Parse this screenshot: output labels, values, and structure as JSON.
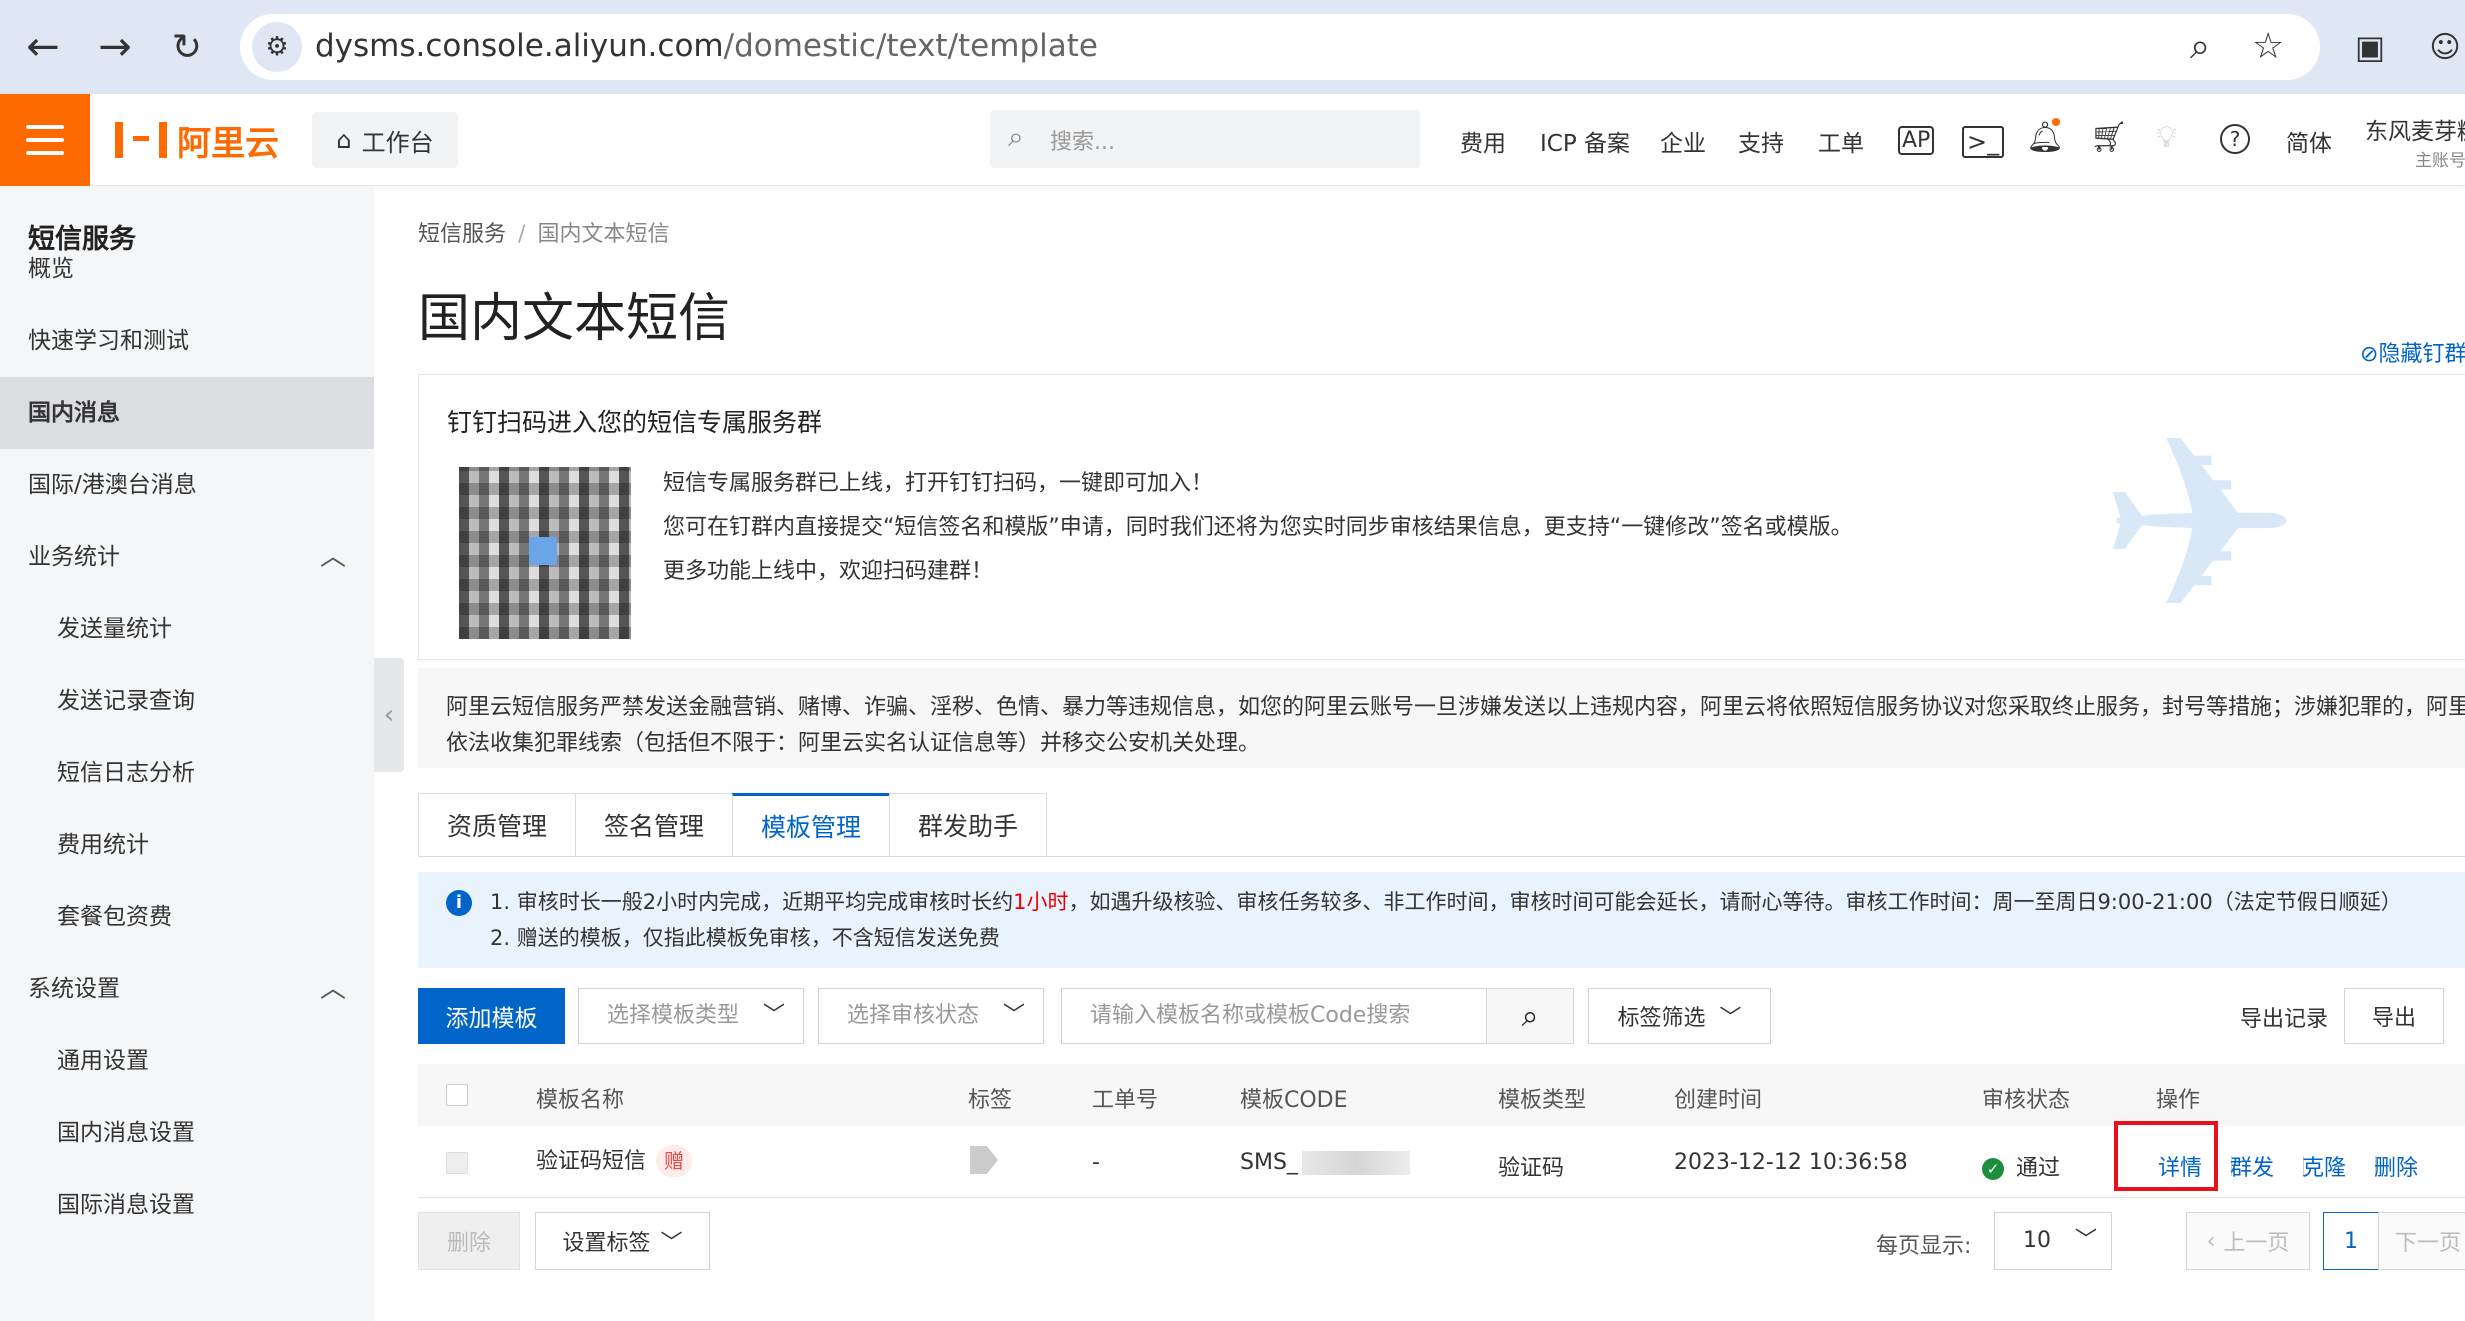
{
  "browser": {
    "url_host": "dysms.console.aliyun.com",
    "url_path": "/domestic/text/template",
    "back_icon": "arrow-left-icon",
    "forward_icon": "arrow-right-icon",
    "reload_icon": "reload-icon"
  },
  "header": {
    "logo_text": "阿里云",
    "workbench_label": "工作台",
    "search_placeholder": "搜索...",
    "nav": [
      "费用",
      "ICP 备案",
      "企业",
      "支持",
      "工单"
    ],
    "lang": "简体",
    "account_name": "东风麦芽糖",
    "account_type": "主账号",
    "accent_color": "#ff6a00"
  },
  "sidebar": {
    "title": "短信服务",
    "items": [
      {
        "label": "概览"
      },
      {
        "label": "快速学习和测试"
      },
      {
        "label": "国内消息"
      },
      {
        "label": "国际/港澳台消息"
      },
      {
        "label": "业务统计"
      },
      {
        "label": "发送量统计"
      },
      {
        "label": "发送记录查询"
      },
      {
        "label": "短信日志分析"
      },
      {
        "label": "费用统计"
      },
      {
        "label": "套餐包资费"
      },
      {
        "label": "系统设置"
      },
      {
        "label": "通用设置"
      },
      {
        "label": "国内消息设置"
      },
      {
        "label": "国际消息设置"
      }
    ]
  },
  "breadcrumb": {
    "root": "短信服务",
    "current": "国内文本短信"
  },
  "page": {
    "title": "国内文本短信",
    "hide_link": "隐藏钉群"
  },
  "ding": {
    "title": "钉钉扫码进入您的短信专属服务群",
    "lines": [
      "短信专属服务群已上线，打开钉钉扫码，一键即可加入！",
      "您可在钉群内直接提交“短信签名和模版”申请，同时我们还将为您实时同步审核结果信息，更支持“一键修改”签名或模版。",
      "更多功能上线中，欢迎扫码建群！"
    ]
  },
  "warning": {
    "line1": "阿里云短信服务严禁发送金融营销、赌博、诈骗、淫秽、色情、暴力等违规信息，如您的阿里云账号一旦涉嫌发送以上违规内容，阿里云将依照短信服务协议对您采取终止服务，封号等措施；涉嫌犯罪的，阿里云",
    "line2": "依法收集犯罪线索（包括但不限于：阿里云实名认证信息等）并移交公安机关处理。"
  },
  "tabs": [
    {
      "label": "资质管理"
    },
    {
      "label": "签名管理"
    },
    {
      "label": "模板管理"
    },
    {
      "label": "群发助手"
    }
  ],
  "notice": {
    "line1_pre": "1. 审核时长一般2小时内完成，近期平均完成审核时长约",
    "line1_red": "1小时",
    "line1_post": "，如遇升级核验、审核任务较多、非工作时间，审核时间可能会延长，请耐心等待。审核工作时间：周一至周日9:00-21:00（法定节假日顺延）",
    "line2": "2. 赠送的模板，仅指此模板免审核，不含短信发送免费"
  },
  "toolbar": {
    "add_label": "添加模板",
    "type_placeholder": "选择模板类型",
    "status_placeholder": "选择审核状态",
    "search_placeholder": "请输入模板名称或模板Code搜索",
    "tag_filter": "标签筛选",
    "export_records": "导出记录",
    "export": "导出"
  },
  "table": {
    "headers": [
      "模板名称",
      "标签",
      "工单号",
      "模板CODE",
      "模板类型",
      "创建时间",
      "审核状态",
      "操作"
    ],
    "rows": [
      {
        "name": "验证码短信",
        "gift": "赠",
        "order": "-",
        "code_prefix": "SMS_",
        "type": "验证码",
        "created": "2023-12-12 10:36:58",
        "status": "通过",
        "actions": [
          "详情",
          "群发",
          "克隆",
          "删除"
        ]
      }
    ]
  },
  "footer": {
    "delete_label": "删除",
    "set_tag_label": "设置标签",
    "per_page_label": "每页显示:",
    "per_page_value": "10",
    "prev": "上一页",
    "page": "1",
    "next": "下一页"
  }
}
